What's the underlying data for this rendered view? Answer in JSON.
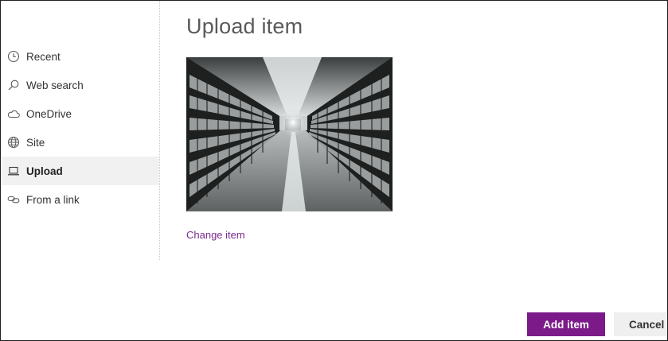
{
  "nav": {
    "items": [
      {
        "label": "Recent",
        "icon": "clock-icon",
        "selected": false
      },
      {
        "label": "Web search",
        "icon": "search-icon",
        "selected": false
      },
      {
        "label": "OneDrive",
        "icon": "cloud-icon",
        "selected": false
      },
      {
        "label": "Site",
        "icon": "globe-icon",
        "selected": false
      },
      {
        "label": "Upload",
        "icon": "laptop-icon",
        "selected": true
      },
      {
        "label": "From a link",
        "icon": "link-icon",
        "selected": false
      }
    ]
  },
  "main": {
    "title": "Upload item",
    "preview_image": "library-aisle-bookshelves-photo",
    "change_link": "Change item"
  },
  "footer": {
    "add_label": "Add item",
    "cancel_label": "Cancel"
  },
  "colors": {
    "accent": "#7d1a8a",
    "link": "#7a2a8e",
    "selected_bg": "#f1f1f1"
  }
}
